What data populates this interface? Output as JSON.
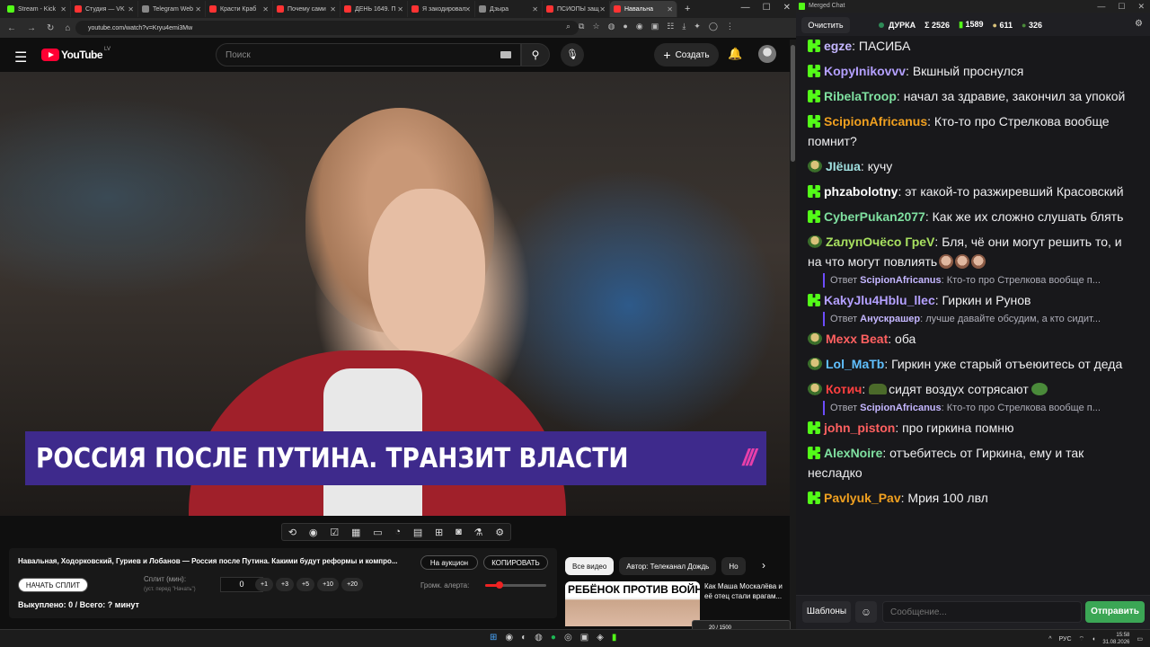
{
  "browser": {
    "tabs": [
      {
        "label": "Stream - Kick",
        "color": "#53fc18"
      },
      {
        "label": "Студия — VK",
        "color": "#ff3333"
      },
      {
        "label": "Telegram Web",
        "color": "#888888"
      },
      {
        "label": "Красти Краб",
        "color": "#ff3333"
      },
      {
        "label": "Почему сами",
        "color": "#ff3333"
      },
      {
        "label": "ДЕНЬ 1649. П",
        "color": "#ff3333"
      },
      {
        "label": "Я закодировал",
        "color": "#ff3333"
      },
      {
        "label": "Дзыра",
        "color": "#888888"
      },
      {
        "label": "ПСИОПЫ защ",
        "color": "#ff3333"
      },
      {
        "label": "Навальна",
        "color": "#ff3333"
      }
    ],
    "url": "youtube.com/watch?v=Kryu4emi3Mw"
  },
  "youtube": {
    "logo_text": "YouTube",
    "country": "LV",
    "search_placeholder": "Поиск",
    "create_label": "Создать",
    "banner_text": "РОССИЯ ПОСЛЕ ПУТИНА. ТРАНЗИТ ВЛАСТИ",
    "banner_logo": "///",
    "chips": [
      "Все видео",
      "Автор: Телеканал Дождь",
      "Но"
    ],
    "rec_thumb_text": "РЕБЁНОК ПРОТИВ ВОЙНЫ",
    "rec_title": "Как Маша Москалёва и её отец стали врагам..."
  },
  "auction_panel": {
    "title": "Навальная, Ходорковский, Гуриев и Лобанов — Россия после Путина. Какими будут реформы и компро...",
    "auction_btn": "На аукцион",
    "copy_btn": "КОПИРОВАТЬ",
    "start_split_btn": "НАЧАТЬ СПЛИТ",
    "split_label": "Сплит (мин):",
    "split_hint": "(уст. перед \"Начать\")",
    "split_value": "0",
    "increments": [
      "+1",
      "+3",
      "+5",
      "+10",
      "+20"
    ],
    "volume_label": "Громк. алерта:",
    "volume_level": 0.23,
    "status": "Выкуплено: 0 / Всего: ? минут"
  },
  "alert_widget": {
    "text": "20 / 1500"
  },
  "taskbar": {
    "lang": "РУС",
    "time": "15:58",
    "date": "31.08.2026"
  },
  "chat": {
    "window_title": "Merged Chat",
    "clear_btn": "Очистить",
    "channel": "ДУРКА",
    "total": "Σ 2526",
    "kick_count": "1589",
    "twitch_count": "611",
    "other_count": "326",
    "messages": [
      {
        "badge": "kick",
        "user": "egze",
        "color": "#c4b6ff",
        "text": "ПАСИБА"
      },
      {
        "badge": "kick",
        "user": "KopyInikovvv",
        "color": "#b4a0ff",
        "text": "Вкшный проснулся"
      },
      {
        "badge": "kick",
        "user": "RibelaTroop",
        "color": "#7fe0a0",
        "text": "начал за здравие, закончил за упокой"
      },
      {
        "badge": "kick",
        "user": "ScipionAfricanus",
        "color": "#f0a020",
        "text": "Кто-то про Стрелкова вообще помнит?"
      },
      {
        "badge": "emote",
        "user": "JIёша",
        "color": "#a0e0e0",
        "text": "кучу"
      },
      {
        "badge": "kick",
        "user": "phzabolotny",
        "color": "#ffffff",
        "text": "эт какой-то разжиревший Красовский"
      },
      {
        "badge": "kick",
        "user": "CyberPukan2077",
        "color": "#7fe0a0",
        "text": "Как же их сложно слушать блять"
      },
      {
        "badge": "emote",
        "user": "ZалупОчёсо ГреV",
        "color": "#a8e060",
        "text": "Бля, чё они могут решить то, и на что могут повлиять"
      },
      {
        "reply_to": "ScipionAfricanus",
        "reply_text": "Кто-то про Стрелкова вообще п..."
      },
      {
        "badge": "kick",
        "user": "KakyJlu4Hblu_llec",
        "color": "#b4a0ff",
        "text": "Гиркин и Рунов"
      },
      {
        "reply_to": "Анускрашер",
        "reply_text": "лучше давайте обсудим, а кто сидит..."
      },
      {
        "badge": "emote",
        "user": "Mexx Beat",
        "color": "#ff6060",
        "text": "оба"
      },
      {
        "badge": "emote",
        "user": "Lol_MaTb",
        "color": "#60c0ff",
        "text": "Гиркин уже старый отъеюитесь от деда"
      },
      {
        "badge": "emote",
        "user": "Котич",
        "color": "#ff4040",
        "text": "сидят воздух сотрясают"
      },
      {
        "reply_to": "ScipionAfricanus",
        "reply_text": "Кто-то про Стрелкова вообще п..."
      },
      {
        "badge": "kick",
        "user": "john_piston",
        "color": "#ff6060",
        "text": "про гиркина помню"
      },
      {
        "badge": "kick",
        "user": "AlexNoire",
        "color": "#7fe0a0",
        "text": "отъебитесь от Гиркина, ему и так несладко"
      },
      {
        "badge": "kick",
        "user": "Pavlyuk_Pav",
        "color": "#f0a020",
        "text": "Мрия 100 лвл"
      }
    ],
    "templates_btn": "Шаблоны",
    "input_placeholder": "Сообщение...",
    "send_btn": "Отправить"
  }
}
